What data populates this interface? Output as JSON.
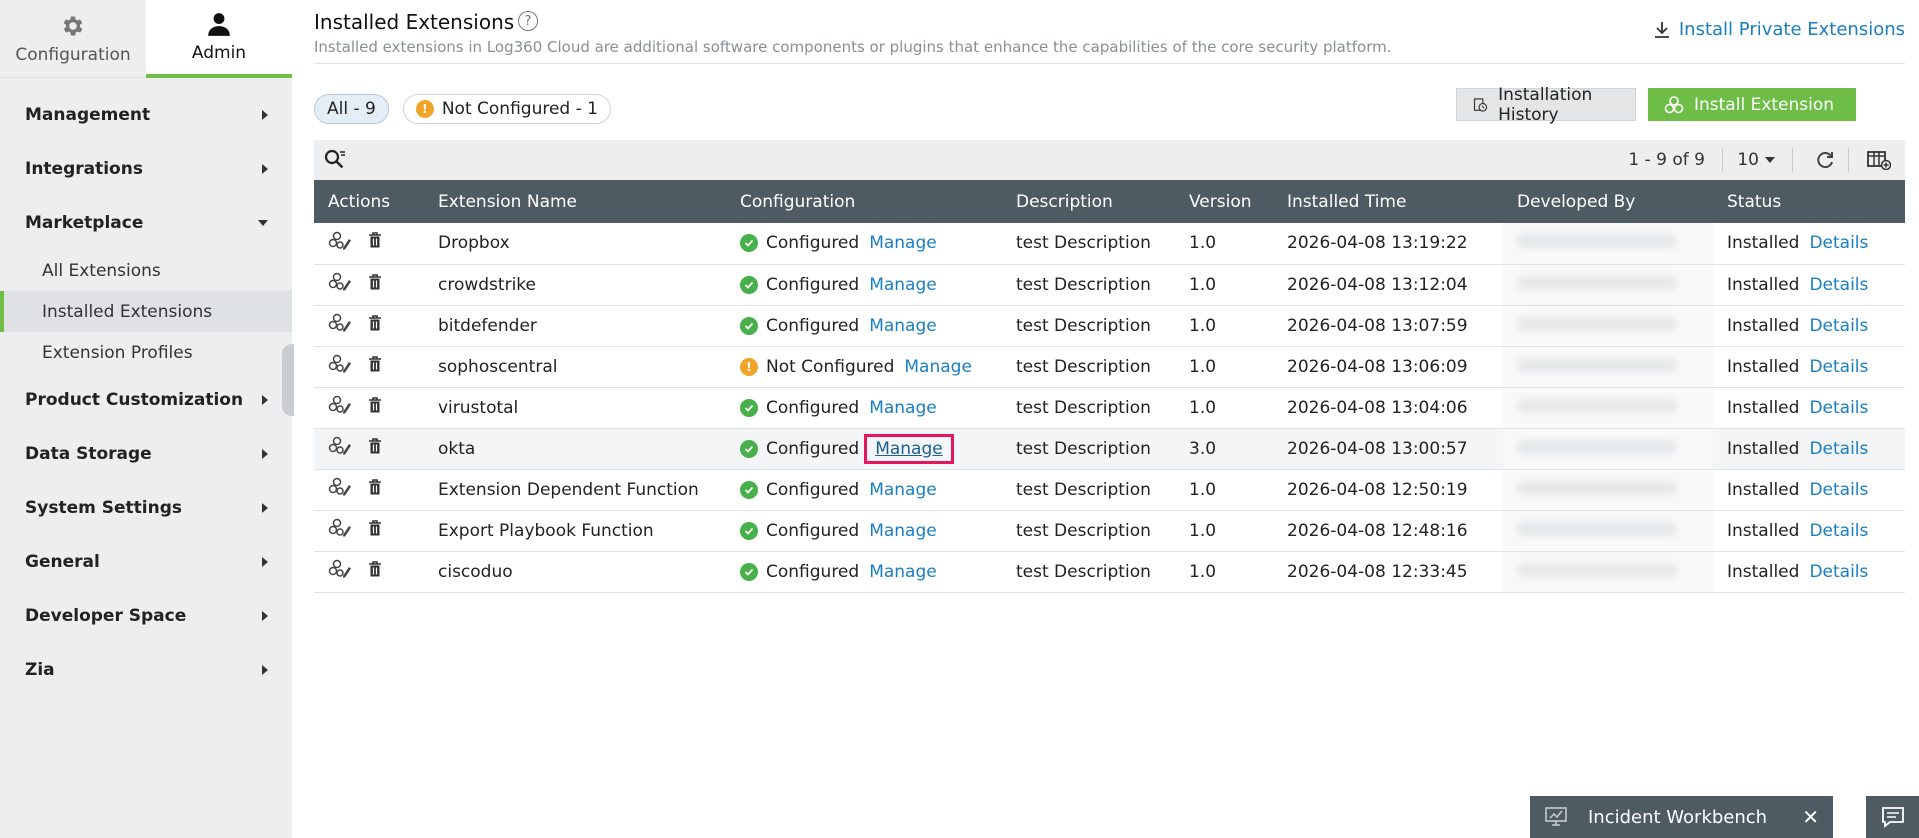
{
  "topnav": {
    "configuration_label": "Configuration",
    "admin_label": "Admin"
  },
  "sidebar": {
    "items": [
      {
        "label": "Management"
      },
      {
        "label": "Integrations"
      },
      {
        "label": "Marketplace"
      },
      {
        "label": "Product Customization"
      },
      {
        "label": "Data Storage"
      },
      {
        "label": "System Settings"
      },
      {
        "label": "General"
      },
      {
        "label": "Developer Space"
      },
      {
        "label": "Zia"
      }
    ],
    "marketplace_sub": [
      {
        "label": "All Extensions"
      },
      {
        "label": "Installed Extensions"
      },
      {
        "label": "Extension Profiles"
      }
    ]
  },
  "header": {
    "title": "Installed Extensions",
    "help": "?",
    "subtitle": "Installed extensions in Log360 Cloud are additional software components or plugins that enhance the capabilities of the core security platform.",
    "private_link": "Install Private Extensions"
  },
  "filters": {
    "all": "All - 9",
    "not_configured": "Not Configured - 1"
  },
  "buttons": {
    "history": "Installation History",
    "install": "Install Extension"
  },
  "toolbar": {
    "pager": "1 - 9 of 9",
    "per_page": "10"
  },
  "table": {
    "headers": [
      "Actions",
      "Extension Name",
      "Configuration",
      "Description",
      "Version",
      "Installed Time",
      "Developed By",
      "Status"
    ],
    "rows": [
      {
        "name": "Dropbox",
        "config": "Configured",
        "manage": "Manage",
        "description": "test Description",
        "version": "1.0",
        "time": "2026-04-08 13:19:22",
        "status": "Installed",
        "details": "Details"
      },
      {
        "name": "crowdstrike",
        "config": "Configured",
        "manage": "Manage",
        "description": "test Description",
        "version": "1.0",
        "time": "2026-04-08 13:12:04",
        "status": "Installed",
        "details": "Details"
      },
      {
        "name": "bitdefender",
        "config": "Configured",
        "manage": "Manage",
        "description": "test Description",
        "version": "1.0",
        "time": "2026-04-08 13:07:59",
        "status": "Installed",
        "details": "Details"
      },
      {
        "name": "sophoscentral",
        "config": "Not Configured",
        "manage": "Manage",
        "description": "test Description",
        "version": "1.0",
        "time": "2026-04-08 13:06:09",
        "status": "Installed",
        "details": "Details"
      },
      {
        "name": "virustotal",
        "config": "Configured",
        "manage": "Manage",
        "description": "test Description",
        "version": "1.0",
        "time": "2026-04-08 13:04:06",
        "status": "Installed",
        "details": "Details"
      },
      {
        "name": "okta",
        "config": "Configured",
        "manage": "Manage",
        "description": "test Description",
        "version": "3.0",
        "time": "2026-04-08 13:00:57",
        "status": "Installed",
        "details": "Details"
      },
      {
        "name": "Extension Dependent Function",
        "config": "Configured",
        "manage": "Manage",
        "description": "test Description",
        "version": "1.0",
        "time": "2026-04-08 12:50:19",
        "status": "Installed",
        "details": "Details"
      },
      {
        "name": "Export Playbook Function",
        "config": "Configured",
        "manage": "Manage",
        "description": "test Description",
        "version": "1.0",
        "time": "2026-04-08 12:48:16",
        "status": "Installed",
        "details": "Details"
      },
      {
        "name": "ciscoduo",
        "config": "Configured",
        "manage": "Manage",
        "description": "test Description",
        "version": "1.0",
        "time": "2026-04-08 12:33:45",
        "status": "Installed",
        "details": "Details"
      }
    ]
  },
  "workbench": {
    "label": "Incident Workbench",
    "close": "✕"
  },
  "colors": {
    "accent_green": "#6dbd47",
    "link_blue": "#1a7ec2",
    "header_dark": "#4f5b63",
    "highlight_red": "#e6165c",
    "warning_orange": "#f0a529"
  }
}
